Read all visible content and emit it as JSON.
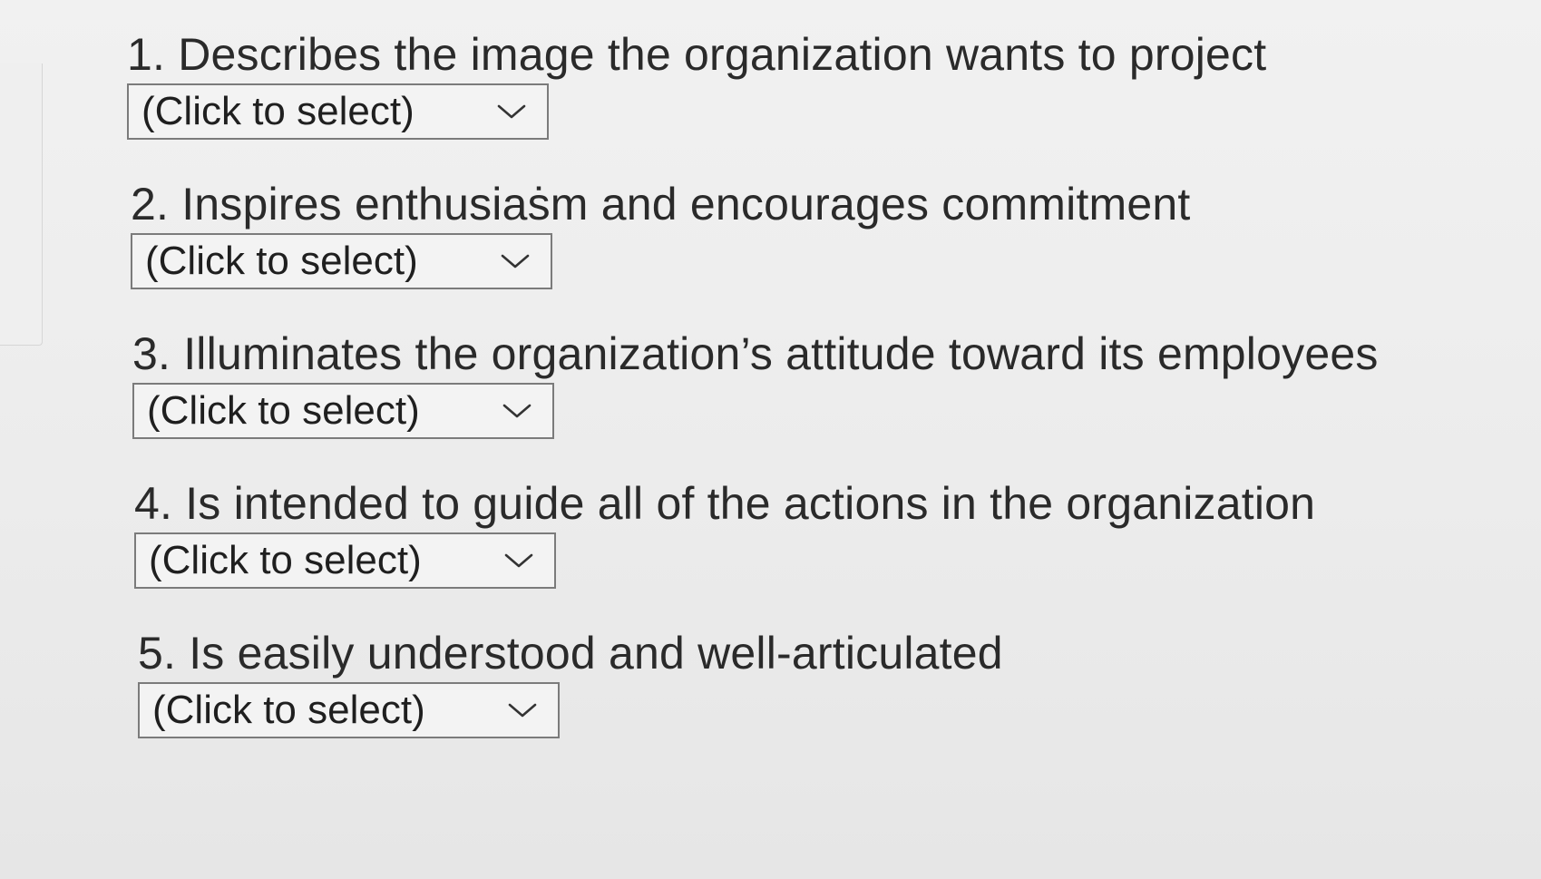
{
  "questions": [
    {
      "text": "1. Describes the image the organization wants to project",
      "select": {
        "value": "(Click to select)"
      }
    },
    {
      "text": "2. Inspires enthusiaṡm and encourages commitment",
      "select": {
        "value": "(Click to select)"
      }
    },
    {
      "text": "3. Illuminates the organization’s attitude toward its employees",
      "select": {
        "value": "(Click to select)"
      }
    },
    {
      "text": "4. Is intended to guide all of the actions in the organization",
      "select": {
        "value": "(Click to select)"
      }
    },
    {
      "text": "5. Is easily understood and well-articulated",
      "select": {
        "value": "(Click to select)"
      }
    }
  ],
  "icons": {
    "dropdown": "chevron-down-icon"
  }
}
